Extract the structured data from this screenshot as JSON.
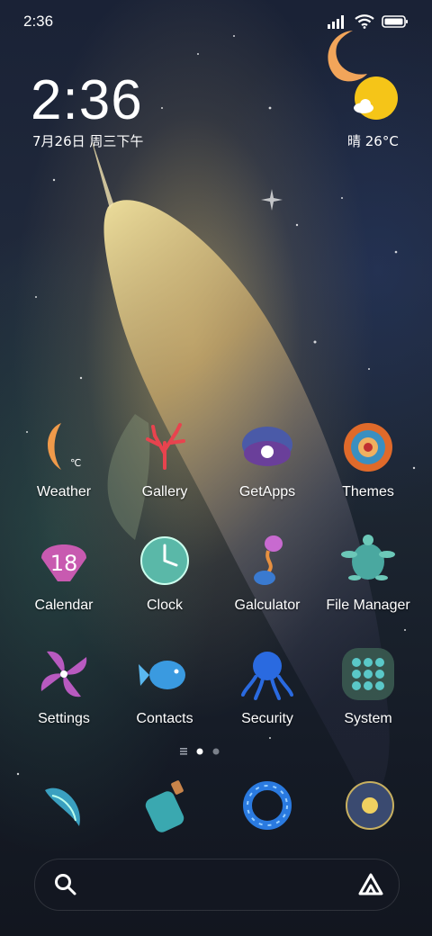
{
  "status_bar": {
    "time": "2:36"
  },
  "clock_widget": {
    "time": "2:36",
    "date": "7月26日 周三下午"
  },
  "weather_widget": {
    "text": "晴 26°C"
  },
  "apps": [
    {
      "label": "Weather",
      "icon": "moon-weather-icon"
    },
    {
      "label": "Gallery",
      "icon": "coral-icon"
    },
    {
      "label": "GetApps",
      "icon": "shell-pearl-icon"
    },
    {
      "label": "Themes",
      "icon": "spiral-shell-icon"
    },
    {
      "label": "Calendar",
      "icon": "scallop-calendar-icon",
      "badge": "18"
    },
    {
      "label": "Clock",
      "icon": "bubble-clock-icon"
    },
    {
      "label": "Galculator",
      "icon": "hourglass-icon"
    },
    {
      "label": "File Manager",
      "icon": "turtle-icon"
    },
    {
      "label": "Settings",
      "icon": "pinwheel-icon"
    },
    {
      "label": "Contacts",
      "icon": "fish-icon"
    },
    {
      "label": "Security",
      "icon": "octopus-icon"
    },
    {
      "label": "System",
      "icon": "bubble-grid-icon"
    }
  ],
  "dock": [
    {
      "icon": "conch-icon"
    },
    {
      "icon": "bottle-icon"
    },
    {
      "icon": "ring-icon"
    },
    {
      "icon": "orb-icon"
    }
  ],
  "page_indicator": {
    "pages": 2,
    "current": 1
  },
  "colors": {
    "accent_sun": "#f5c518",
    "moon": "#f0a050"
  }
}
